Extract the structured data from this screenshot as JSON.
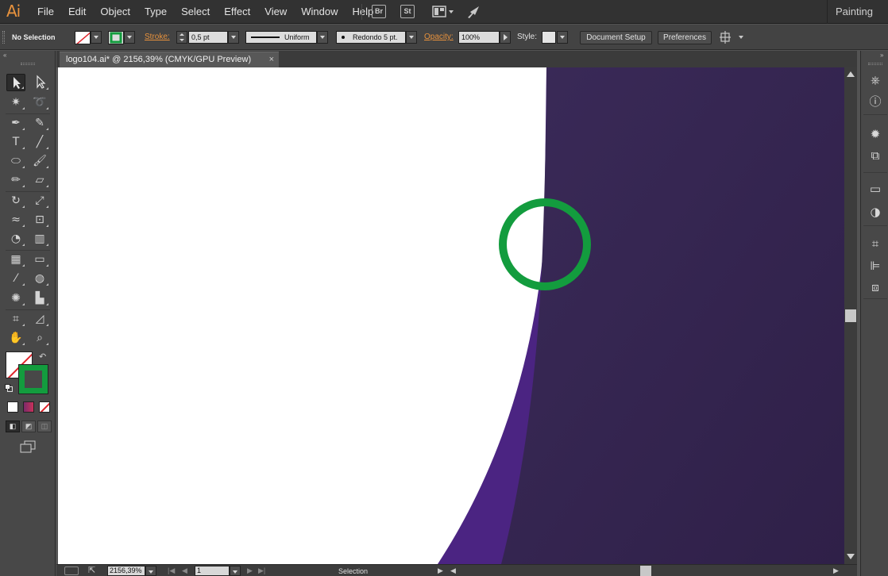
{
  "app": {
    "logo": "Ai"
  },
  "menu": [
    "File",
    "Edit",
    "Object",
    "Type",
    "Select",
    "Effect",
    "View",
    "Window",
    "Help"
  ],
  "menubar_icons": {
    "bridge": "Br",
    "stock": "St"
  },
  "workspace": "Painting",
  "control": {
    "selection": "No Selection",
    "stroke_label": "Stroke:",
    "stroke_weight": "0,5 pt",
    "profile": "Uniform",
    "brush": "Redondo 5 pt.",
    "opacity_label": "Opacity:",
    "opacity": "100%",
    "style_label": "Style:",
    "document_setup": "Document Setup",
    "preferences": "Preferences"
  },
  "document": {
    "tab_title": "logo104.ai* @ 2156,39% (CMYK/GPU Preview)",
    "close": "×"
  },
  "status": {
    "zoom": "2156,39%",
    "artboard": "1",
    "tool": "Selection"
  },
  "colors": {
    "ui_bg": "#535353",
    "accent": "#e8923d",
    "artwork_dark": "#34234f",
    "artwork_light": "#4b2482",
    "highlight_ring": "#139c3e",
    "fill_none_slash": "#e0242b"
  }
}
